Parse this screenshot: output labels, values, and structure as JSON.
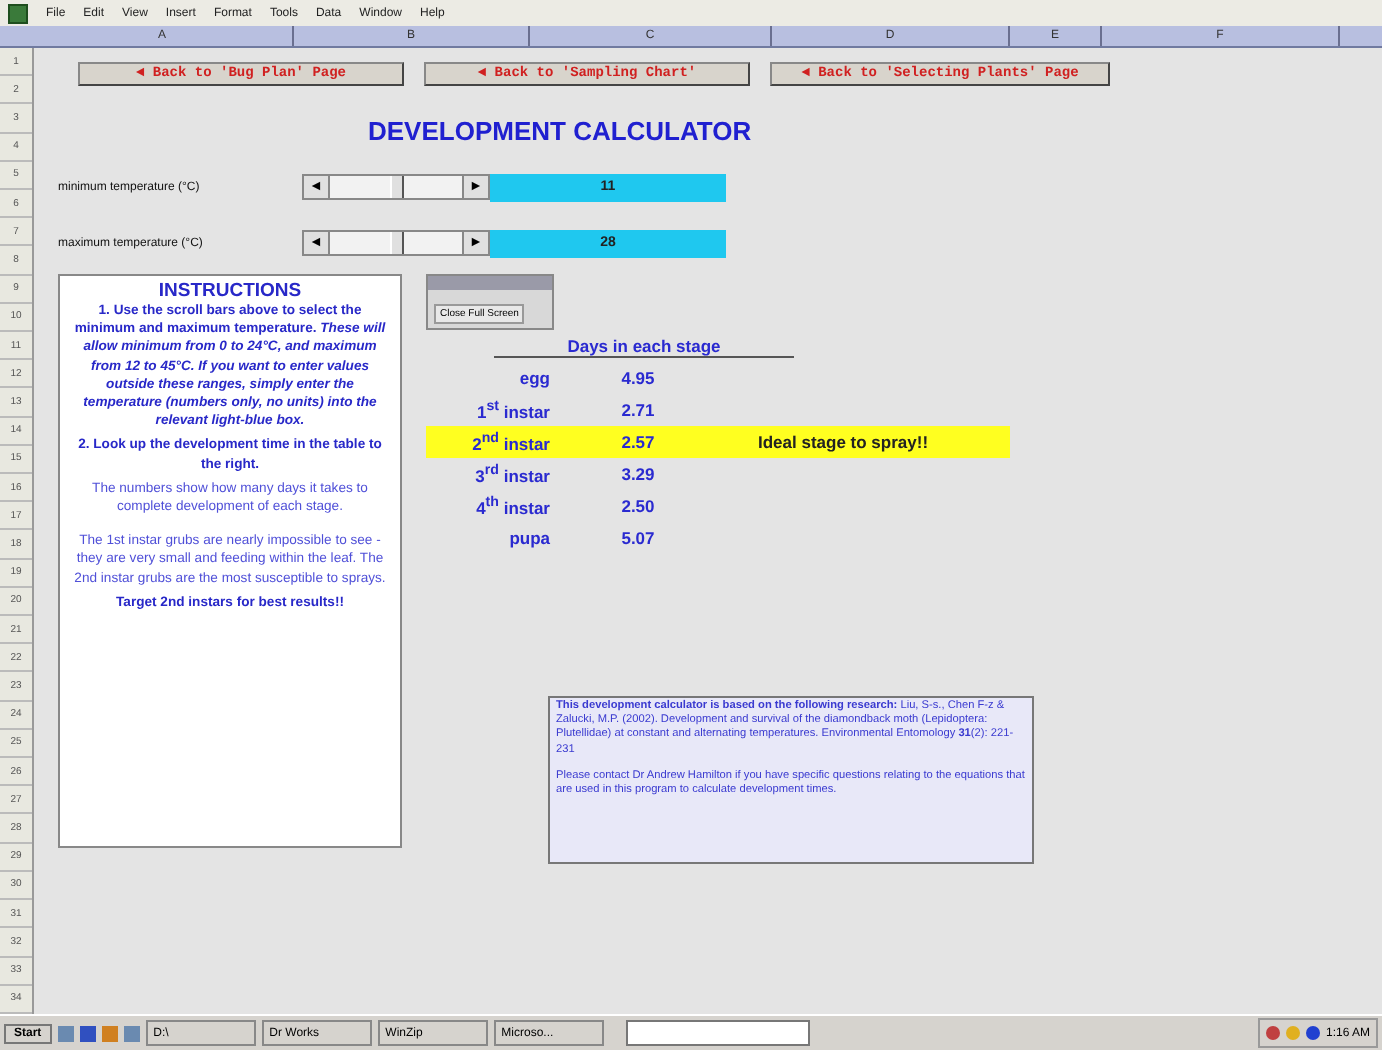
{
  "menu_bar": [
    "File",
    "Edit",
    "View",
    "Insert",
    "Format",
    "Tools",
    "Data",
    "Window",
    "Help"
  ],
  "columns": [
    "A",
    "B",
    "C",
    "D",
    "E",
    "F"
  ],
  "rows": [
    "1",
    "2",
    "3",
    "4",
    "5",
    "6",
    "7",
    "8",
    "9",
    "10",
    "11",
    "12",
    "13",
    "14",
    "15",
    "16",
    "17",
    "18",
    "19",
    "20",
    "21",
    "22",
    "23",
    "24",
    "25",
    "26",
    "27",
    "28",
    "29",
    "30",
    "31",
    "32",
    "33",
    "34"
  ],
  "nav_buttons": [
    "◄ Back to 'Bug Plan' Page",
    "◄ Back to 'Sampling Chart'",
    "◄ Back to 'Selecting Plants' Page"
  ],
  "title": "DEVELOPMENT CALCULATOR",
  "sliders": [
    {
      "label": "minimum temperature (°C)",
      "left": "◄",
      "right": "►",
      "value": "11"
    },
    {
      "label": "maximum temperature (°C)",
      "left": "◄",
      "right": "►",
      "value": "28"
    }
  ],
  "instructions": {
    "heading": "INSTRUCTIONS",
    "paragraphs": [
      {
        "kind": "bold",
        "text": "1. Use the scroll bars above to select the minimum and maximum temperature. *These will allow minimum from 0 to 24°C, and maximum from 12 to 45°C.  If you want to enter values outside these ranges, simply enter the temperature (numbers only, no units) into the relevant light-blue box.*"
      },
      {
        "kind": "bold",
        "text": "2. Look up the development time in the table to the right."
      },
      {
        "kind": "plain",
        "text": "The numbers show how many days it takes to complete development of each stage."
      },
      {
        "kind": "plain",
        "text": "The 1st instar grubs are nearly impossible to see - they are very small and feeding within the leaf.  The 2nd instar grubs are the most susceptible to sprays."
      },
      {
        "kind": "bold",
        "text": "Target 2nd instars for best results!!"
      }
    ]
  },
  "full_screen_toolbar": {
    "button": "Close Full Screen"
  },
  "stage_table": {
    "heading": "Days in each stage",
    "rows": [
      {
        "stage": "egg",
        "days": "4.95",
        "highlighted": false
      },
      {
        "stage": "1$^{st}$ instar",
        "days": "2.71",
        "highlighted": false
      },
      {
        "stage": "2$^{nd}$ instar",
        "days": "2.57",
        "highlighted": true,
        "note": "Ideal stage to spray!!"
      },
      {
        "stage": "3$^{rd}$ instar",
        "days": "3.29",
        "highlighted": false
      },
      {
        "stage": "4$^{th}$ instar",
        "days": "2.50",
        "highlighted": false
      },
      {
        "stage": "pupa",
        "days": "5.07",
        "highlighted": false
      }
    ]
  },
  "research_note": {
    "paragraphs": [
      "**This development calculator is based on the following research:** Liu, S-s., Chen F-z & Zalucki, M.P. (2002). Development and survival of the diamondback moth (Lepidoptera: Plutellidae) at constant and alternating temperatures. Environmental Entomology **31**(2): 221-231",
      "Please contact Dr Andrew Hamilton if you have specific questions relating to the equations that are used in this program to calculate development times."
    ]
  },
  "taskbar": {
    "start": "Start",
    "tasks": [
      "D:\\",
      "Dr Works",
      "WinZip",
      "Microso..."
    ],
    "clock": "1:16 AM"
  }
}
